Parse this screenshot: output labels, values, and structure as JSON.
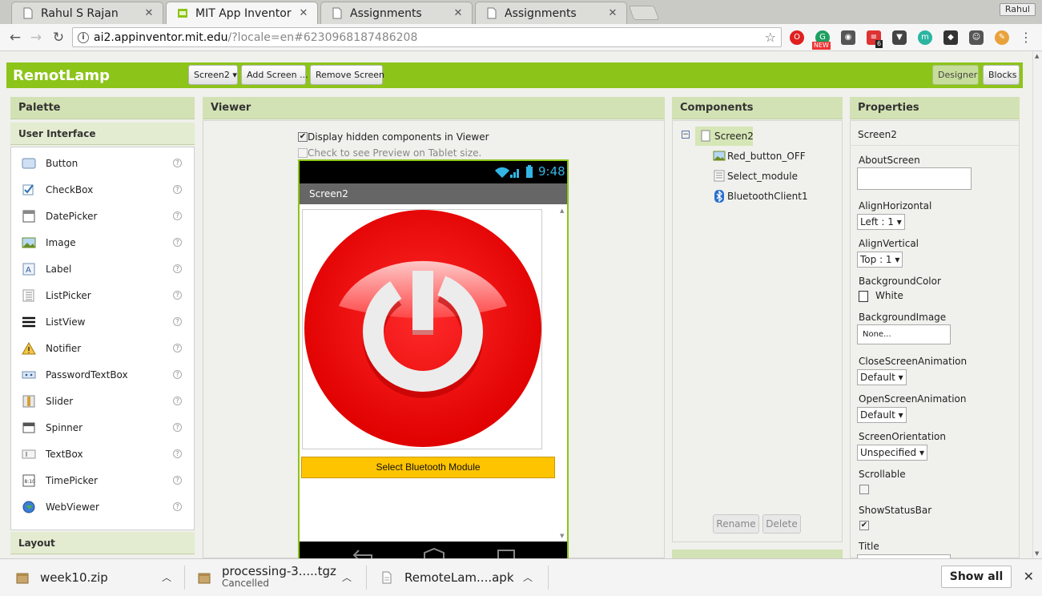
{
  "browser": {
    "tabs": [
      {
        "title": "Rahul S Rajan"
      },
      {
        "title": "MIT App Inventor"
      },
      {
        "title": "Assignments"
      },
      {
        "title": "Assignments"
      }
    ],
    "profile": "Rahul",
    "url_host": "ai2.appinventor.mit.edu",
    "url_path": "/?locale=en#6230968187486208",
    "ext_new_badge": "NEW",
    "ext_count_badge": "6"
  },
  "app": {
    "name": "RemotLamp",
    "screen_select": "Screen2 ▾",
    "add_screen": "Add Screen ...",
    "remove_screen": "Remove Screen",
    "designer": "Designer",
    "blocks": "Blocks"
  },
  "palette": {
    "title": "Palette",
    "section": "User Interface",
    "items": [
      "Button",
      "CheckBox",
      "DatePicker",
      "Image",
      "Label",
      "ListPicker",
      "ListView",
      "Notifier",
      "PasswordTextBox",
      "Slider",
      "Spinner",
      "TextBox",
      "TimePicker",
      "WebViewer"
    ],
    "help": "?",
    "layout_section": "Layout"
  },
  "viewer": {
    "title": "Viewer",
    "display_hidden": "Display hidden components in Viewer",
    "tablet_preview": "Check to see Preview on Tablet size.",
    "time": "9:48",
    "screen_title": "Screen2",
    "select_button": "Select Bluetooth Module"
  },
  "components": {
    "title": "Components",
    "root": "Screen2",
    "children": [
      "Red_button_OFF",
      "Select_module",
      "BluetoothClient1"
    ],
    "rename": "Rename",
    "delete": "Delete"
  },
  "properties": {
    "title": "Properties",
    "component": "Screen2",
    "about_screen": "AboutScreen",
    "align_horizontal": "AlignHorizontal",
    "align_horizontal_value": "Left : 1 ▾",
    "align_vertical": "AlignVertical",
    "align_vertical_value": "Top : 1 ▾",
    "background_color": "BackgroundColor",
    "background_color_value": "White",
    "background_image": "BackgroundImage",
    "background_image_value": "None...",
    "close_anim": "CloseScreenAnimation",
    "close_anim_value": "Default ▾",
    "open_anim": "OpenScreenAnimation",
    "open_anim_value": "Default ▾",
    "orientation": "ScreenOrientation",
    "orientation_value": "Unspecified ▾",
    "scrollable": "Scrollable",
    "show_status_bar": "ShowStatusBar",
    "title_label": "Title",
    "checkmark": "✔"
  },
  "downloads": {
    "items": [
      {
        "name": "week10.zip",
        "status": ""
      },
      {
        "name": "processing-3.....tgz",
        "status": "Cancelled"
      },
      {
        "name": "RemoteLam....apk",
        "status": ""
      }
    ],
    "show_all": "Show all"
  },
  "colors": {
    "accent": "#8cc419",
    "button_yellow": "#ffc400",
    "power_red": "#ff0000"
  }
}
